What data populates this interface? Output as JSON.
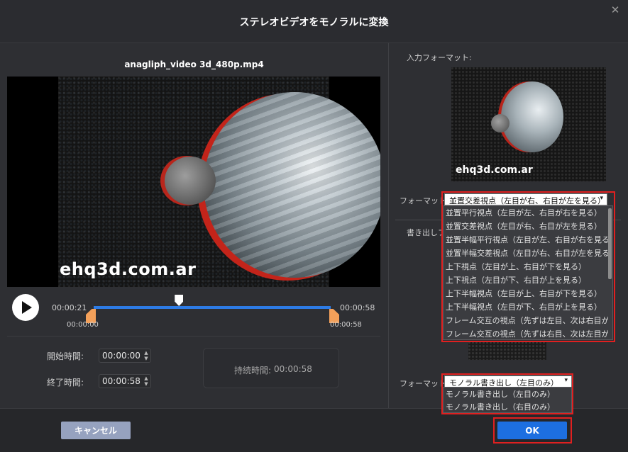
{
  "dialog": {
    "title": "ステレオビデオをモノラルに変換",
    "close_glyph": "✕"
  },
  "video": {
    "filename": "anagliph_video 3d_480p.mp4",
    "watermark": "ehq3d.com.ar",
    "current_time": "00:00:21",
    "total_time": "00:00:58",
    "trim_start_label": "00:00:00",
    "trim_end_label": "00:00:58",
    "playhead_fraction": 0.36
  },
  "trim": {
    "start_label": "開始時間:",
    "start_value": "00:00:00",
    "end_label": "終了時間:",
    "end_value": "00:00:58",
    "duration_label": "持続時間:",
    "duration_value": "00:00:58"
  },
  "right_panel": {
    "input_format_label": "入力フォーマット:",
    "thumb_watermark": "ehq3d.com.ar",
    "format_label": "フォーマット:",
    "format_selected": "並置交差視点（左目が右、右目が左を見る）",
    "format_options": [
      "並置平行視点（左目が左、右目が右を見る）",
      "並置交差視点（左目が右、右目が左を見る）",
      "並置半幅平行視点（左目が左、右目が右を見る）",
      "並置半幅交差視点（左目が右、右目が左を見る）",
      "上下視点（左目が上、右目が下を見る）",
      "上下視点（左目が下、右目が上を見る）",
      "上下半幅視点（左目が上、右目が下を見る）",
      "上下半幅視点（左目が下、右目が上を見る）",
      "フレーム交互の視点（先ずは左目、次は右目が…",
      "フレーム交互の視点（先ずは右目、次は左目が…"
    ],
    "output_label_partial": "書き出しフ",
    "output_format_label": "フォーマット:",
    "output_selected": "モノラル書き出し（左目のみ）",
    "output_options": [
      "モノラル書き出し（左目のみ）",
      "モノラル書き出し（右目のみ）"
    ]
  },
  "footer": {
    "cancel_label": "キャンセル",
    "ok_label": "OK"
  },
  "icons": {
    "play": "play-icon",
    "close": "close-icon",
    "caret": "▾",
    "spin_up": "▲",
    "spin_down": "▼"
  },
  "colors": {
    "accent": "#1d6fe0",
    "highlight_box": "#e02020",
    "trim_handle": "#f3a05a",
    "timeline": "#2d7be5"
  }
}
